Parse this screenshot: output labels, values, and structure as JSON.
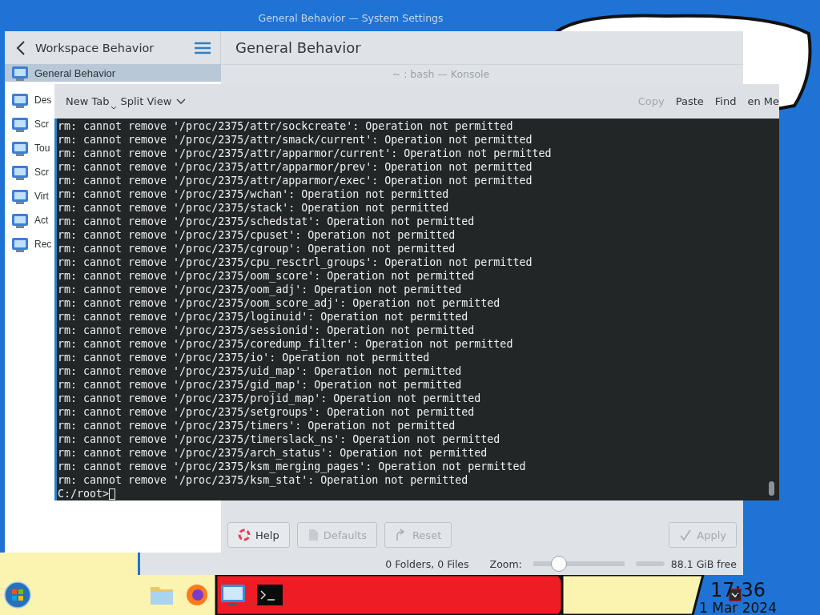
{
  "settings_window": {
    "title": "General Behavior — System Settings",
    "sidebar": {
      "heading": "Workspace Behavior",
      "items": [
        {
          "label": "General Behavior",
          "selected": true
        },
        {
          "label": "Des",
          "selected": false
        },
        {
          "label": "Scr",
          "selected": false
        },
        {
          "label": "Tou",
          "selected": false
        },
        {
          "label": "Scr",
          "selected": false
        },
        {
          "label": "Virt",
          "selected": false
        },
        {
          "label": "Act",
          "selected": false
        },
        {
          "label": "Rec",
          "selected": false
        }
      ]
    },
    "page_title": "General Behavior",
    "buttons": [
      {
        "label": "Help",
        "kind": "help",
        "disabled": false
      },
      {
        "label": "Defaults",
        "kind": "defaults",
        "disabled": true
      },
      {
        "label": "Reset",
        "kind": "reset",
        "disabled": true
      },
      {
        "label": "Apply",
        "kind": "apply",
        "disabled": true
      }
    ]
  },
  "file_manager_status": {
    "summary": "0 Folders, 0 Files",
    "zoom_label": "Zoom:",
    "zoom": {
      "level": 0.28
    },
    "free_space": "88.1 GiB free"
  },
  "konsole": {
    "title": "~ : bash — Konsole",
    "toolbar": [
      {
        "label": "New Tab",
        "kind": "split",
        "disabled": false
      },
      {
        "label": "Split View",
        "kind": "dropdown",
        "disabled": false
      },
      {
        "label": "Copy",
        "kind": "plain",
        "disabled": true
      },
      {
        "label": "Paste",
        "kind": "plain",
        "disabled": false
      },
      {
        "label": "Find",
        "kind": "plain",
        "disabled": false
      },
      {
        "label": "en Me",
        "kind": "plain",
        "disabled": false
      }
    ],
    "lines": [
      "rm: cannot remove '/proc/2375/attr/sockcreate': Operation not permitted",
      "rm: cannot remove '/proc/2375/attr/smack/current': Operation not permitted",
      "rm: cannot remove '/proc/2375/attr/apparmor/current': Operation not permitted",
      "rm: cannot remove '/proc/2375/attr/apparmor/prev': Operation not permitted",
      "rm: cannot remove '/proc/2375/attr/apparmor/exec': Operation not permitted",
      "rm: cannot remove '/proc/2375/wchan': Operation not permitted",
      "rm: cannot remove '/proc/2375/stack': Operation not permitted",
      "rm: cannot remove '/proc/2375/schedstat': Operation not permitted",
      "rm: cannot remove '/proc/2375/cpuset': Operation not permitted",
      "rm: cannot remove '/proc/2375/cgroup': Operation not permitted",
      "rm: cannot remove '/proc/2375/cpu_resctrl_groups': Operation not permitted",
      "rm: cannot remove '/proc/2375/oom_score': Operation not permitted",
      "rm: cannot remove '/proc/2375/oom_adj': Operation not permitted",
      "rm: cannot remove '/proc/2375/oom_score_adj': Operation not permitted",
      "rm: cannot remove '/proc/2375/loginuid': Operation not permitted",
      "rm: cannot remove '/proc/2375/sessionid': Operation not permitted",
      "rm: cannot remove '/proc/2375/coredump_filter': Operation not permitted",
      "rm: cannot remove '/proc/2375/io': Operation not permitted",
      "rm: cannot remove '/proc/2375/uid_map': Operation not permitted",
      "rm: cannot remove '/proc/2375/gid_map': Operation not permitted",
      "rm: cannot remove '/proc/2375/projid_map': Operation not permitted",
      "rm: cannot remove '/proc/2375/setgroups': Operation not permitted",
      "rm: cannot remove '/proc/2375/timers': Operation not permitted",
      "rm: cannot remove '/proc/2375/timerslack_ns': Operation not permitted",
      "rm: cannot remove '/proc/2375/arch_status': Operation not permitted",
      "rm: cannot remove '/proc/2375/ksm_merging_pages': Operation not permitted",
      "rm: cannot remove '/proc/2375/ksm_stat': Operation not permitted"
    ],
    "prompt": "C:/root>"
  },
  "taskbar": {
    "time": "17:36",
    "date": "1 Mar 2024"
  }
}
